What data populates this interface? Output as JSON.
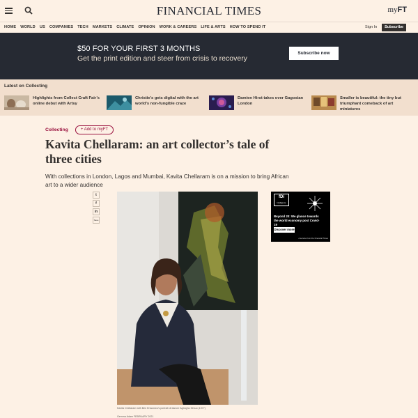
{
  "header": {
    "masthead": "FINANCIAL TIMES",
    "myft_prefix": "my",
    "myft_suffix": "FT",
    "nav": [
      "HOME",
      "WORLD",
      "US",
      "COMPANIES",
      "TECH",
      "MARKETS",
      "CLIMATE",
      "OPINION",
      "WORK & CAREERS",
      "LIFE & ARTS",
      "HOW TO SPEND IT"
    ],
    "sign_in": "Sign In",
    "subscribe": "Subscribe"
  },
  "promo": {
    "headline": "$50 FOR YOUR FIRST 3 MONTHS",
    "subline": "Get the print edition and steer from crisis to recovery",
    "button": "Subscribe now"
  },
  "latest": {
    "title": "Latest on Collecting",
    "items": [
      {
        "text": "Highlights from Collect Craft Fair’s online debut with Artsy"
      },
      {
        "text": "Christie’s gets digital with the art world’s non-fungible craze"
      },
      {
        "text": "Damien Hirst takes over Gagosian London"
      },
      {
        "text": "Smaller is beautiful: the tiny but triumphant comeback of art miniatures"
      }
    ]
  },
  "article": {
    "topic": "Collecting",
    "add_myft": "+ Add to myFT",
    "headline": "Kavita Chellaram: an art collector’s tale of three cities",
    "standfirst": "With collections in London, Lagos and Mumbai, Kavita Chellaram is on a mission to bring African art to a wider audience",
    "caption": "Kavita Chellaram with Ben Enwonwu’s portrait of dancer Agbogho Mmuo (1977)",
    "byline": "Gemma Adam   FEBRUARY 2021"
  },
  "share": [
    "t",
    "f",
    "in",
    "Save"
  ],
  "ad": {
    "logo_line1": "fDi",
    "logo_line2": "Intelligence",
    "text": "Beyond 20: We glance towards the world economy post Covid-19",
    "button": "Discover more",
    "footer": "A service from the Financial Times"
  },
  "colors": {
    "background": "#fdf1e5",
    "banner": "#262a33",
    "accent": "#990f3d",
    "latest_bg": "#f2dfce"
  }
}
